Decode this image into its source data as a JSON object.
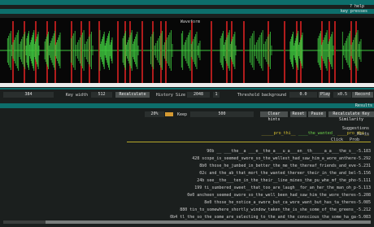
{
  "app": {
    "help_label": "? help",
    "key_press_label": "key presses"
  },
  "waveform": {
    "title": "Waveform"
  },
  "controls": {
    "record_label": "Record",
    "record_seconds": "x0.5",
    "play_label": "Play",
    "threshold_value": "0.0",
    "threshold_label": "Threshold background",
    "history_value": "1",
    "history_size_label": "History Size",
    "history_size_value": "2048",
    "recalculate_label": "Recalculate",
    "fft_value": "512",
    "key_width_label": "Key width",
    "key_width_value": "384"
  },
  "results": {
    "header": "Results",
    "recalc_button": "Recalculate Key Similarity",
    "pause_button": "Pause",
    "reset_button": "Reset",
    "clear_hints_button": "Clear hints",
    "hint_value": "500",
    "keep_label": "Keep",
    "keep_value": "20%",
    "side_labels": [
      "Suggestions",
      "Hints",
      "Prob",
      "Click"
    ],
    "rows": [
      {
        "num": "-5.183",
        "text": "90b  __ ___the__a  ___e__the_a___u_a___en__th_____a_a___the_s__",
        "hl": ""
      },
      {
        "num": "-5.292",
        "text": "428 scope_is_seemed_swore_so_the_wellest_had_saw_him_a_wore_anthere",
        "hl": ""
      },
      {
        "num": "-5.231",
        "text": "8b0 those_he_jumbed_in_better_the_me_the_thereaf_friends_and_eve",
        "hl": ""
      },
      {
        "num": "-5.156",
        "text": "02c and_the_ab_that_mort_the_wanted_thereer_their_in_the_and_bel",
        "hl": ""
      },
      {
        "num": "-5.111",
        "text": "24b see__the___ten_in_the_their__line_mines_the_pu_whe_mf_the_pho",
        "hl": ""
      },
      {
        "num": "-5.113",
        "text": "199 ti_sumbered_sweet__that_too_are_laugh__for_an_her_the_man_oh_p",
        "hl": ""
      },
      {
        "num": "-5.208",
        "text": "0e0 ancheen_seemed_swore_so_the_well_been_had_saw_him_the_wore_theres",
        "hl": ""
      },
      {
        "num": "-5.085",
        "text": "8e0 those_he_notice_a_swore_but_ca_wore_want_but_has_ta_theres",
        "hl": ""
      },
      {
        "num": "-5.212",
        "text": "880 tin_to_somewhere_shortly_window_taken_the_is_she_some_of_the_greens_",
        "hl": ""
      },
      {
        "num": "-5.083",
        "text": "0b4 tl_the_so_the_some_are_selecting_to_the_and_the_conscious_the_some_ha_ga",
        "hl": ""
      }
    ],
    "top_line_left": "_____pro_thi__",
    "top_line_mid": "____the_wanted_",
    "top_line_right": "____pro_thi__"
  },
  "colors": {
    "accent": "#0d6e6b",
    "wave": "#3ec63e",
    "marker": "#b01c1c",
    "highlight": "#6cd04a"
  }
}
